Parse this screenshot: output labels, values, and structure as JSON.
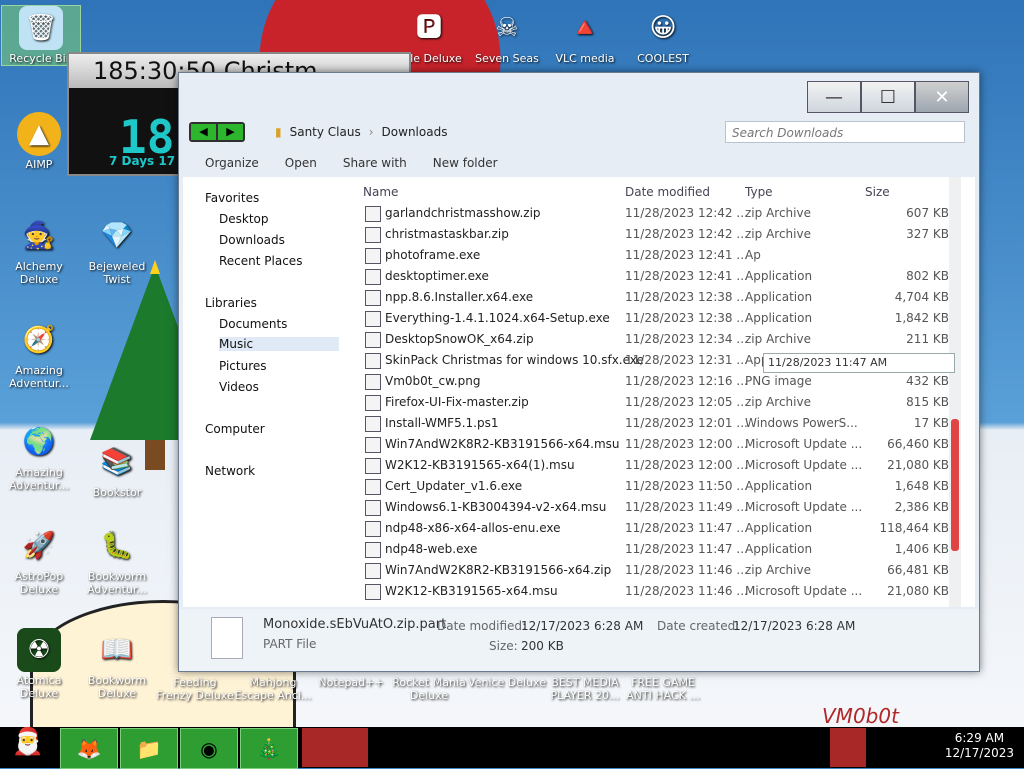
{
  "desktop": {
    "icons": [
      {
        "label": "Recycle Bin",
        "icon": "recycle-bin-icon"
      },
      {
        "label": "AIMP",
        "icon": "aimp-icon"
      },
      {
        "label": "Deluxe",
        "icon": "game-icon"
      },
      {
        "label": "Alchemy Deluxe",
        "icon": "wizard-icon"
      },
      {
        "label": "Bejeweled Twist",
        "icon": "gem-icon"
      },
      {
        "label": "Amazing Adventur...",
        "icon": "compass-icon"
      },
      {
        "label": "Amazing Adventur...",
        "icon": "globe-icon"
      },
      {
        "label": "Bookstor",
        "icon": "books-icon"
      },
      {
        "label": "AstroPop Deluxe",
        "icon": "astropop-icon"
      },
      {
        "label": "Bookworm Adventur...",
        "icon": "worm-icon"
      },
      {
        "label": "Atomica Deluxe",
        "icon": "atomica-icon"
      },
      {
        "label": "Bookworm Deluxe",
        "icon": "book-icon"
      },
      {
        "label": "Feeding Frenzy Deluxe",
        "icon": "fish-icon"
      },
      {
        "label": "Mahjong Escape Anci...",
        "icon": "mahjong-icon"
      },
      {
        "label": "Notepad++",
        "icon": "notepad-icon"
      },
      {
        "label": "Rocket Mania Deluxe",
        "icon": "rocket-icon"
      },
      {
        "label": "Venice Deluxe",
        "icon": "venice-icon"
      },
      {
        "label": "BEST MEDIA PLAYER 20...",
        "icon": "media-player-icon"
      },
      {
        "label": "FREE GAME ANTI HACK ...",
        "icon": "game-icon"
      },
      {
        "label": "ggle Deluxe",
        "icon": "game-icon"
      },
      {
        "label": "Seven Seas",
        "icon": "pirate-icon"
      },
      {
        "label": "VLC media",
        "icon": "vlc-icon"
      },
      {
        "label": "COOLEST",
        "icon": "smiley-icon"
      }
    ]
  },
  "timer_gadget": {
    "title": "185:30:50 Christm",
    "big": "18",
    "small": "7 Days 17"
  },
  "explorer": {
    "breadcrumb": [
      "Santy Claus",
      "Downloads"
    ],
    "search_placeholder": "Search Downloads",
    "toolbar": {
      "organize": "Organize",
      "open": "Open",
      "share_with": "Share with",
      "new_folder": "New folder"
    },
    "nav": {
      "favorites": "Favorites",
      "desktop": "Desktop",
      "downloads": "Downloads",
      "recent_places": "Recent Places",
      "libraries": "Libraries",
      "documents": "Documents",
      "music": "Music",
      "pictures": "Pictures",
      "videos": "Videos",
      "computer": "Computer",
      "network": "Network"
    },
    "columns": {
      "name": "Name",
      "date": "Date modified",
      "type": "Type",
      "size": "Size"
    },
    "tooltip": "11/28/2023 11:47 AM",
    "files": [
      {
        "name": "garlandchristmasshow.zip",
        "date": "11/28/2023 12:42 ...",
        "type": "zip Archive",
        "size": "607 KB"
      },
      {
        "name": "christmastaskbar.zip",
        "date": "11/28/2023 12:42 ...",
        "type": "zip Archive",
        "size": "327 KB"
      },
      {
        "name": "photoframe.exe",
        "date": "11/28/2023 12:41 ...",
        "type": "Ap",
        "size": ""
      },
      {
        "name": "desktoptimer.exe",
        "date": "11/28/2023 12:41 ...",
        "type": "Application",
        "size": "802 KB"
      },
      {
        "name": "npp.8.6.Installer.x64.exe",
        "date": "11/28/2023 12:38 ...",
        "type": "Application",
        "size": "4,704 KB"
      },
      {
        "name": "Everything-1.4.1.1024.x64-Setup.exe",
        "date": "11/28/2023 12:38 ...",
        "type": "Application",
        "size": "1,842 KB"
      },
      {
        "name": "DesktopSnowOK_x64.zip",
        "date": "11/28/2023 12:34 ...",
        "type": "zip Archive",
        "size": "211 KB"
      },
      {
        "name": "SkinPack Christmas for windows 10.sfx.exe",
        "date": "11/28/2023 12:31 ...",
        "type": "Application",
        "size": "10,470 KB"
      },
      {
        "name": "Vm0b0t_cw.png",
        "date": "11/28/2023 12:16 ...",
        "type": "PNG image",
        "size": "432 KB"
      },
      {
        "name": "Firefox-UI-Fix-master.zip",
        "date": "11/28/2023 12:05 ...",
        "type": "zip Archive",
        "size": "815 KB"
      },
      {
        "name": "Install-WMF5.1.ps1",
        "date": "11/28/2023 12:01 ...",
        "type": "Windows PowerS...",
        "size": "17 KB"
      },
      {
        "name": "Win7AndW2K8R2-KB3191566-x64.msu",
        "date": "11/28/2023 12:00 ...",
        "type": "Microsoft Update ...",
        "size": "66,460 KB"
      },
      {
        "name": "W2K12-KB3191565-x64(1).msu",
        "date": "11/28/2023 12:00 ...",
        "type": "Microsoft Update ...",
        "size": "21,080 KB"
      },
      {
        "name": "Cert_Updater_v1.6.exe",
        "date": "11/28/2023 11:50 ...",
        "type": "Application",
        "size": "1,648 KB"
      },
      {
        "name": "Windows6.1-KB3004394-v2-x64.msu",
        "date": "11/28/2023 11:49 ...",
        "type": "Microsoft Update ...",
        "size": "2,386 KB"
      },
      {
        "name": "ndp48-x86-x64-allos-enu.exe",
        "date": "11/28/2023 11:47 ...",
        "type": "Application",
        "size": "118,464 KB"
      },
      {
        "name": "ndp48-web.exe",
        "date": "11/28/2023 11:47 ...",
        "type": "Application",
        "size": "1,406 KB"
      },
      {
        "name": "Win7AndW2K8R2-KB3191566-x64.zip",
        "date": "11/28/2023 11:46 ...",
        "type": "zip Archive",
        "size": "66,481 KB"
      },
      {
        "name": "W2K12-KB3191565-x64.msu",
        "date": "11/28/2023 11:46 ...",
        "type": "Microsoft Update ...",
        "size": "21,080 KB"
      }
    ],
    "details": {
      "filename": "Monoxide.sEbVuAtO.zip.part",
      "filetype": "PART File",
      "modified_label": "Date modified:",
      "modified_value": "12/17/2023 6:28 AM",
      "created_label": "Date created:",
      "created_value": "12/17/2023 6:28 AM",
      "size_label": "Size:",
      "size_value": "200 KB"
    }
  },
  "taskbar": {
    "time": "6:29 AM",
    "date": "12/17/2023"
  },
  "watermark": "VM0b0t"
}
